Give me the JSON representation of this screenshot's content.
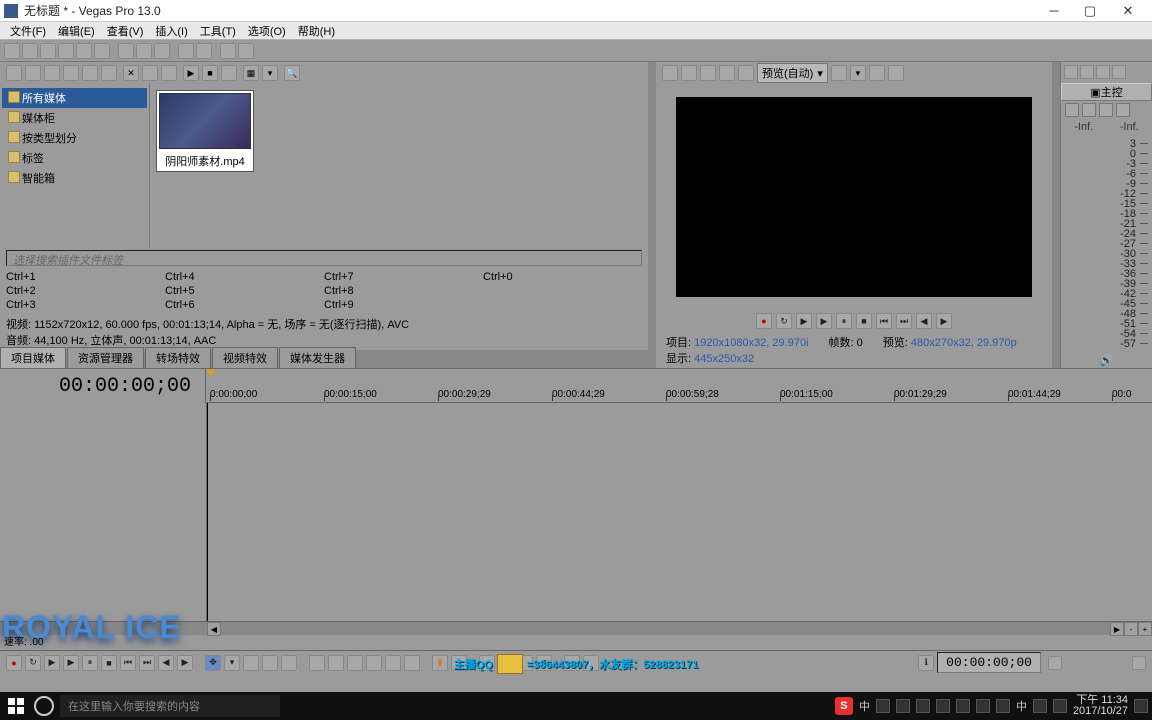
{
  "window": {
    "title": "无标题 * - Vegas Pro 13.0"
  },
  "menu": {
    "file": "文件(F)",
    "edit": "编辑(E)",
    "view": "查看(V)",
    "insert": "插入(I)",
    "tools": "工具(T)",
    "options": "选项(O)",
    "help": "帮助(H)"
  },
  "tree": {
    "root": "所有媒体",
    "items": [
      "媒体柜",
      "按类型划分",
      "标签",
      "智能箱"
    ]
  },
  "thumb": {
    "name": "阴阳师素材.mp4"
  },
  "search_placeholder": "选择搜索插件文件标签",
  "shortcuts": {
    "c1": [
      "Ctrl+1",
      "Ctrl+2",
      "Ctrl+3"
    ],
    "c2": [
      "Ctrl+4",
      "Ctrl+5",
      "Ctrl+6"
    ],
    "c3": [
      "Ctrl+7",
      "Ctrl+8",
      "Ctrl+9"
    ],
    "c4": [
      "Ctrl+0"
    ]
  },
  "mediainfo": {
    "video": "视频: 1152x720x12, 60.000 fps, 00:01:13;14,  Alpha = 无,  场序 = 无(逐行扫描), AVC",
    "audio": "音频: 44,100 Hz, 立体声, 00:01:13;14, AAC"
  },
  "tabs": {
    "t1": "项目媒体",
    "t2": "资源管理器",
    "t3": "转场特效",
    "t4": "视频特效",
    "t5": "媒体发生器"
  },
  "preview_combo": "预览(自动)",
  "previewinfo": {
    "proj_l": "项目:",
    "proj_v": "1920x1080x32, 29.970i",
    "frame_l": "帧数:",
    "frame_v": "0",
    "prev_l": "预览:",
    "prev_v": "480x270x32, 29.970p",
    "disp_l": "显示:",
    "disp_v": "445x250x32"
  },
  "master": {
    "title": "主控",
    "inf": "-Inf.",
    "scale": [
      "3",
      "0",
      "-3",
      "-6",
      "-9",
      "-12",
      "-15",
      "-18",
      "-21",
      "-24",
      "-27",
      "-30",
      "-33",
      "-36",
      "-39",
      "-42",
      "-45",
      "-48",
      "-51",
      "-54",
      "-57"
    ]
  },
  "timeline": {
    "tc": "00:00:00;00",
    "ticks": [
      {
        "pos": 6,
        "label": "0:00:00;00"
      },
      {
        "pos": 120,
        "label": "00:00:15;00"
      },
      {
        "pos": 234,
        "label": "00:00:29;29"
      },
      {
        "pos": 348,
        "label": "00:00:44;29"
      },
      {
        "pos": 462,
        "label": "00:00:59;28"
      },
      {
        "pos": 576,
        "label": "00:01:15;00"
      },
      {
        "pos": 690,
        "label": "00:01:29;29"
      },
      {
        "pos": 804,
        "label": "00:01:44;29"
      },
      {
        "pos": 908,
        "label": "00:0"
      }
    ],
    "rate": "速率: .00"
  },
  "bottom_tc": "00:00:00;00",
  "logo": "ROYAL ICE",
  "banner": {
    "pre": "主播QQ",
    "mid": "=386443807，水友群：528823171"
  },
  "taskbar": {
    "search": "在这里输入你要搜索的内容",
    "ime": "中",
    "ime2": "中",
    "time": "下午 11:34",
    "date": "2017/10/27"
  }
}
